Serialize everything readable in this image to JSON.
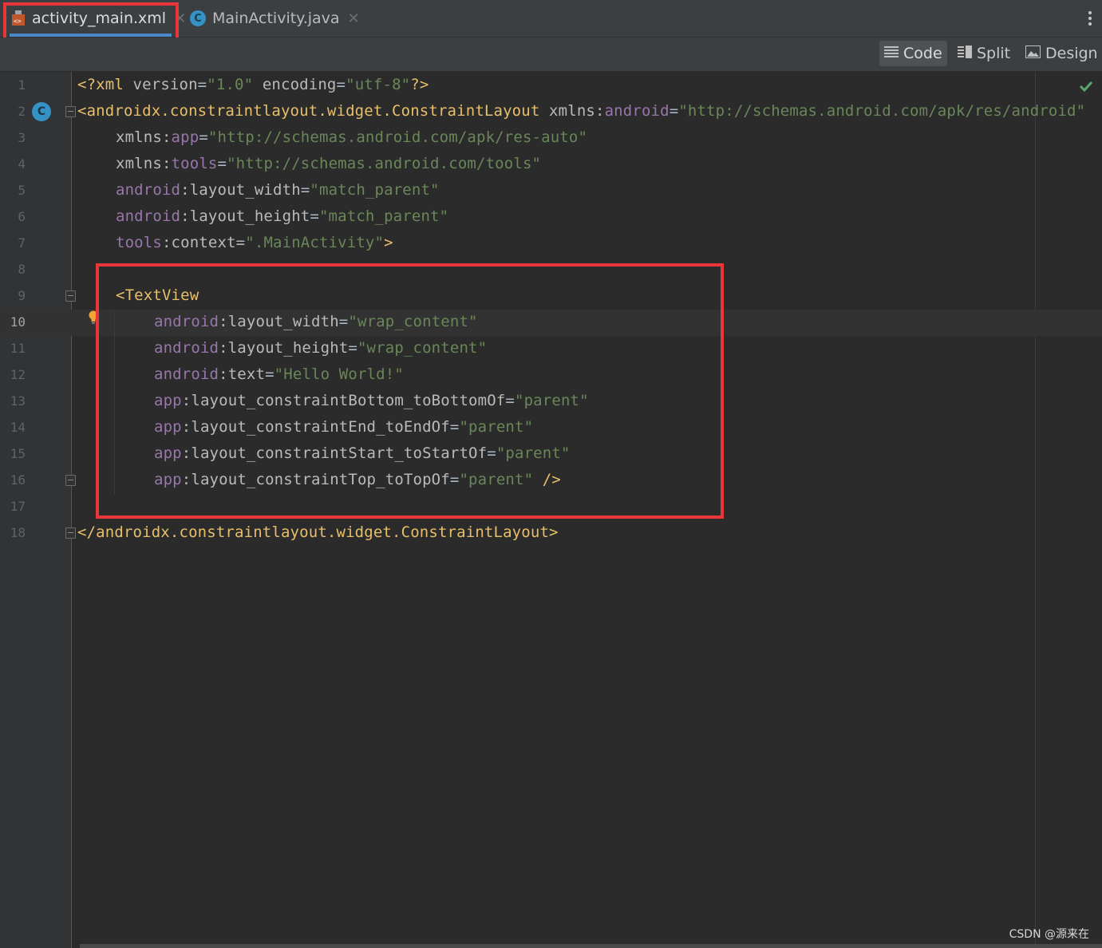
{
  "tabs": [
    {
      "label": "activity_main.xml",
      "active": true,
      "icon": "xml-layout-icon"
    },
    {
      "label": "MainActivity.java",
      "active": false,
      "icon": "java-class-icon"
    }
  ],
  "view_modes": [
    {
      "label": "Code",
      "selected": true,
      "icon": "code-lines-icon"
    },
    {
      "label": "Split",
      "selected": false,
      "icon": "split-view-icon"
    },
    {
      "label": "Design",
      "selected": false,
      "icon": "design-image-icon"
    }
  ],
  "gutter_class_marker": "C",
  "current_line": 10,
  "lines": [
    {
      "n": "1",
      "tokens": [
        [
          "tag",
          "<?xml "
        ],
        [
          "attr",
          "version"
        ],
        [
          "plain",
          "="
        ],
        [
          "str",
          "\"1.0\""
        ],
        [
          "plain",
          " "
        ],
        [
          "attr",
          "encoding"
        ],
        [
          "plain",
          "="
        ],
        [
          "str",
          "\"utf-8\""
        ],
        [
          "tag",
          "?>"
        ]
      ]
    },
    {
      "n": "2",
      "tokens": [
        [
          "tag",
          "<androidx.constraintlayout.widget.ConstraintLayout "
        ],
        [
          "attr",
          "xmlns:"
        ],
        [
          "ns",
          "android"
        ],
        [
          "plain",
          "="
        ],
        [
          "str",
          "\"http://schemas.android.com/apk/res/android\""
        ]
      ]
    },
    {
      "n": "3",
      "tokens": [
        [
          "attr",
          "xmlns:"
        ],
        [
          "ns",
          "app"
        ],
        [
          "plain",
          "="
        ],
        [
          "str",
          "\"http://schemas.android.com/apk/res-auto\""
        ]
      ]
    },
    {
      "n": "4",
      "tokens": [
        [
          "attr",
          "xmlns:"
        ],
        [
          "ns",
          "tools"
        ],
        [
          "plain",
          "="
        ],
        [
          "str",
          "\"http://schemas.android.com/tools\""
        ]
      ]
    },
    {
      "n": "5",
      "tokens": [
        [
          "ns",
          "android"
        ],
        [
          "attr",
          ":layout_width"
        ],
        [
          "plain",
          "="
        ],
        [
          "str",
          "\"match_parent\""
        ]
      ]
    },
    {
      "n": "6",
      "tokens": [
        [
          "ns",
          "android"
        ],
        [
          "attr",
          ":layout_height"
        ],
        [
          "plain",
          "="
        ],
        [
          "str",
          "\"match_parent\""
        ]
      ]
    },
    {
      "n": "7",
      "tokens": [
        [
          "ns",
          "tools"
        ],
        [
          "attr",
          ":context"
        ],
        [
          "plain",
          "="
        ],
        [
          "str",
          "\".MainActivity\""
        ],
        [
          "tag",
          ">"
        ]
      ]
    },
    {
      "n": "8",
      "tokens": []
    },
    {
      "n": "9",
      "tokens": [
        [
          "tag",
          "<TextView"
        ]
      ]
    },
    {
      "n": "10",
      "tokens": [
        [
          "ns",
          "android"
        ],
        [
          "attr",
          ":layout_width"
        ],
        [
          "plain",
          "="
        ],
        [
          "str",
          "\"wrap_content\""
        ]
      ]
    },
    {
      "n": "11",
      "tokens": [
        [
          "ns",
          "android"
        ],
        [
          "attr",
          ":layout_height"
        ],
        [
          "plain",
          "="
        ],
        [
          "str",
          "\"wrap_content\""
        ]
      ]
    },
    {
      "n": "12",
      "tokens": [
        [
          "ns",
          "android"
        ],
        [
          "attr",
          ":text"
        ],
        [
          "plain",
          "="
        ],
        [
          "str",
          "\"Hello World!\""
        ]
      ]
    },
    {
      "n": "13",
      "tokens": [
        [
          "ns",
          "app"
        ],
        [
          "attr",
          ":layout_constraintBottom_toBottomOf"
        ],
        [
          "plain",
          "="
        ],
        [
          "str",
          "\"parent\""
        ]
      ]
    },
    {
      "n": "14",
      "tokens": [
        [
          "ns",
          "app"
        ],
        [
          "attr",
          ":layout_constraintEnd_toEndOf"
        ],
        [
          "plain",
          "="
        ],
        [
          "str",
          "\"parent\""
        ]
      ]
    },
    {
      "n": "15",
      "tokens": [
        [
          "ns",
          "app"
        ],
        [
          "attr",
          ":layout_constraintStart_toStartOf"
        ],
        [
          "plain",
          "="
        ],
        [
          "str",
          "\"parent\""
        ]
      ]
    },
    {
      "n": "16",
      "tokens": [
        [
          "ns",
          "app"
        ],
        [
          "attr",
          ":layout_constraintTop_toTopOf"
        ],
        [
          "plain",
          "="
        ],
        [
          "str",
          "\"parent\""
        ],
        [
          "plain",
          " "
        ],
        [
          "tag",
          "/>"
        ]
      ]
    },
    {
      "n": "17",
      "tokens": []
    },
    {
      "n": "18",
      "tokens": [
        [
          "tag",
          "</androidx.constraintlayout.widget.ConstraintLayout>"
        ]
      ]
    }
  ],
  "watermark": "CSDN @源来在",
  "status_icon": "check-icon"
}
